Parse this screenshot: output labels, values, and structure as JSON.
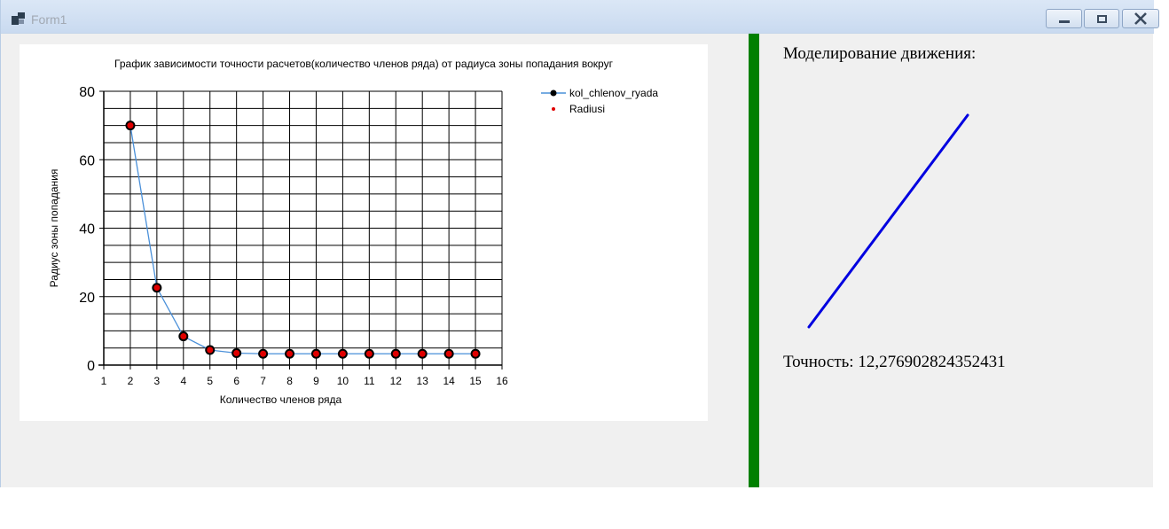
{
  "window": {
    "title": "Form1",
    "icon": "app-form-icon",
    "buttons": [
      "minimize-icon",
      "maximize-icon",
      "close-icon"
    ]
  },
  "chart_data": {
    "type": "line",
    "title": "График зависимости точности расчетов(количество членов ряда) от радиуса зоны попадания вокруг",
    "xlabel": "Количество членов ряда",
    "ylabel": "Радиус зоны попадания",
    "xlim": [
      1,
      16
    ],
    "ylim": [
      0,
      80
    ],
    "x_ticks": [
      1,
      2,
      3,
      4,
      5,
      6,
      7,
      8,
      9,
      10,
      11,
      12,
      13,
      14,
      15,
      16
    ],
    "y_ticks": [
      0,
      20,
      40,
      60,
      80
    ],
    "grid": true,
    "legend_position": "top-right, outside plot",
    "series": [
      {
        "name": "kol_chlenov_ryada",
        "kind": "line-with-markers",
        "color": "#4a90d9",
        "marker_color": "#000000",
        "x": [
          2,
          3,
          4,
          5,
          6,
          7,
          8,
          9,
          10,
          11,
          12,
          13,
          14,
          15
        ],
        "y": [
          70,
          22.6,
          8.4,
          4.4,
          3.5,
          3.3,
          3.3,
          3.3,
          3.3,
          3.3,
          3.3,
          3.3,
          3.3,
          3.3
        ]
      },
      {
        "name": "Radiusi",
        "kind": "points",
        "color": "#e00000",
        "x": [
          2,
          3,
          4,
          5,
          6,
          7,
          8,
          9,
          10,
          11,
          12,
          13,
          14,
          15
        ],
        "y": [
          70,
          22.6,
          8.4,
          4.4,
          3.5,
          3.3,
          3.3,
          3.3,
          3.3,
          3.3,
          3.3,
          3.3,
          3.3,
          3.3
        ]
      }
    ]
  },
  "simulation": {
    "title": "Моделирование движения:",
    "accuracy_text": "Точность: 12,276902824352431",
    "divider_color": "#008000",
    "line_color": "#0000e0"
  }
}
